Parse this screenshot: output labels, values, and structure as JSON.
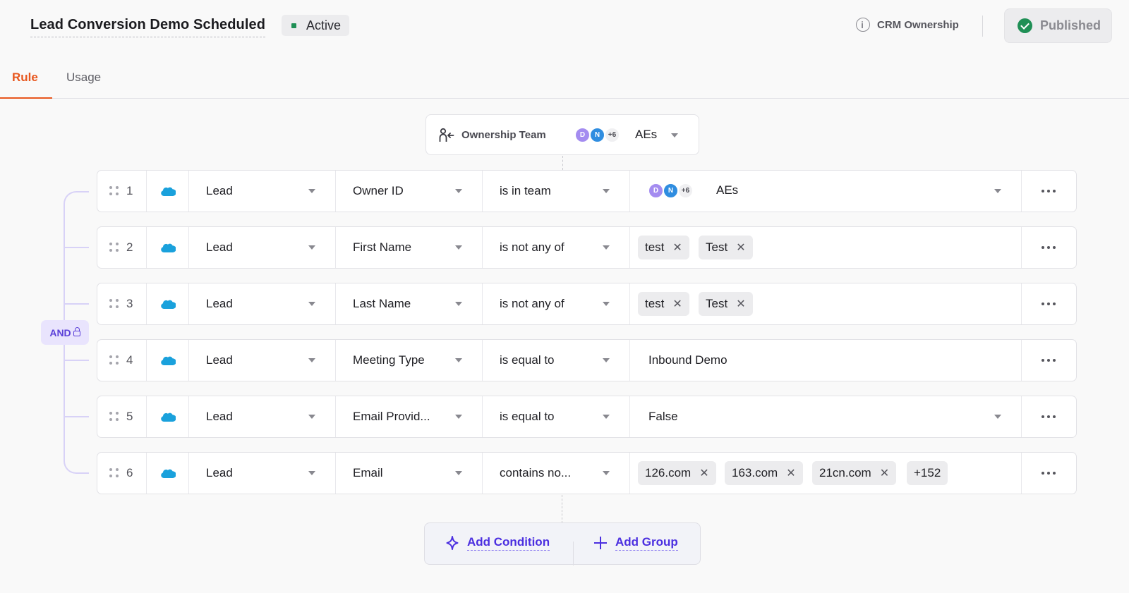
{
  "header": {
    "title": "Lead Conversion Demo Scheduled",
    "status": "Active",
    "crm_link": "CRM Ownership",
    "published": "Published"
  },
  "tabs": [
    {
      "label": "Rule",
      "active": true
    },
    {
      "label": "Usage",
      "active": false
    }
  ],
  "ownership": {
    "label": "Ownership Team",
    "avatars": [
      "D",
      "N"
    ],
    "more": "+6",
    "team": "AEs"
  },
  "group": {
    "operator": "AND"
  },
  "conditions": [
    {
      "num": "1",
      "object": "Lead",
      "field": "Owner ID",
      "operator": "is in team",
      "value": {
        "type": "team",
        "avatars": [
          "D",
          "N"
        ],
        "more": "+6",
        "team": "AEs"
      }
    },
    {
      "num": "2",
      "object": "Lead",
      "field": "First Name",
      "operator": "is not any of",
      "value": {
        "type": "chips",
        "chips": [
          "test",
          "Test"
        ]
      }
    },
    {
      "num": "3",
      "object": "Lead",
      "field": "Last Name",
      "operator": "is not any of",
      "value": {
        "type": "chips",
        "chips": [
          "test",
          "Test"
        ]
      }
    },
    {
      "num": "4",
      "object": "Lead",
      "field": "Meeting Type",
      "operator": "is equal to",
      "value": {
        "type": "text",
        "text": "Inbound Demo"
      }
    },
    {
      "num": "5",
      "object": "Lead",
      "field": "Email Provid...",
      "operator": "is equal to",
      "value": {
        "type": "select",
        "text": "False"
      }
    },
    {
      "num": "6",
      "object": "Lead",
      "field": "Email",
      "operator": "contains no...",
      "value": {
        "type": "chips",
        "chips": [
          "126.com",
          "163.com",
          "21cn.com"
        ],
        "more": "+152"
      }
    }
  ],
  "actions": {
    "add_condition": "Add Condition",
    "add_group": "Add Group"
  },
  "colors": {
    "accent": "#e8571e",
    "primary": "#4b2fe0",
    "success": "#1f8f55",
    "salesforce": "#1aa1dc"
  },
  "icons": {
    "info": "info-icon",
    "check": "check-circle-icon",
    "owner": "owner-assign-icon",
    "drag": "drag-handle-icon",
    "crm": "salesforce-cloud-icon",
    "more": "more-horizontal-icon",
    "sparkle": "sparkle-icon",
    "plus": "plus-icon",
    "lock": "lock-icon"
  }
}
